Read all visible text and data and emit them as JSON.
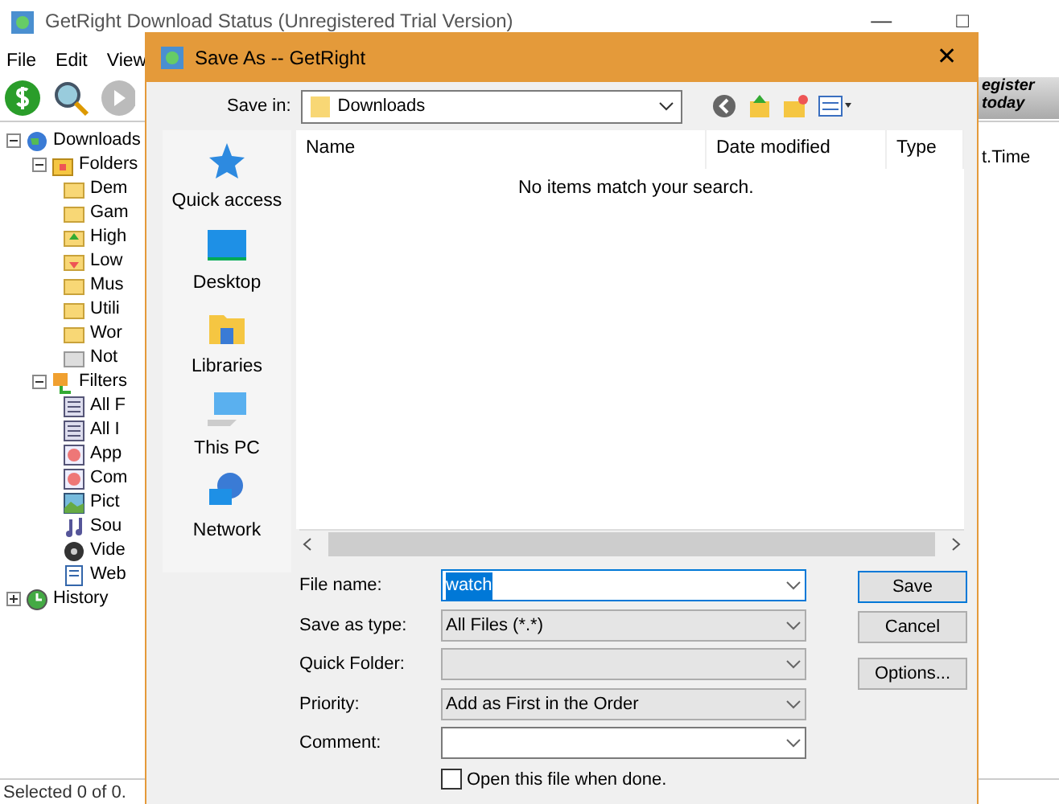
{
  "app": {
    "title": "GetRight Download Status (Unregistered Trial Version)",
    "window_buttons": [
      "—",
      "□"
    ],
    "menu": [
      "File",
      "Edit",
      "View"
    ],
    "tree": [
      {
        "label": "Downloads",
        "kind": "globe",
        "expanded": true,
        "children": [
          {
            "label": "Folders",
            "kind": "folder-special",
            "expanded": true,
            "children": [
              {
                "label": "Dem",
                "kind": "folder"
              },
              {
                "label": "Gam",
                "kind": "folder"
              },
              {
                "label": "High",
                "kind": "folder-up"
              },
              {
                "label": "Low",
                "kind": "folder-down"
              },
              {
                "label": "Mus",
                "kind": "folder"
              },
              {
                "label": "Utili",
                "kind": "folder"
              },
              {
                "label": "Wor",
                "kind": "folder"
              },
              {
                "label": "Not",
                "kind": "folder-gray"
              }
            ]
          },
          {
            "label": "Filters",
            "kind": "filter",
            "expanded": true,
            "children": [
              {
                "label": "All F",
                "kind": "list"
              },
              {
                "label": "All I",
                "kind": "list"
              },
              {
                "label": "App",
                "kind": "app"
              },
              {
                "label": "Com",
                "kind": "app"
              },
              {
                "label": "Pict",
                "kind": "picture-file"
              },
              {
                "label": "Sou",
                "kind": "sound"
              },
              {
                "label": "Vide",
                "kind": "video"
              },
              {
                "label": "Web",
                "kind": "web"
              }
            ]
          }
        ]
      },
      {
        "label": "History",
        "kind": "history",
        "expanded": false
      }
    ],
    "register": [
      "egister",
      "today"
    ],
    "column": "t.Time",
    "status_bar": "Selected 0 of 0."
  },
  "dialog": {
    "title": "Save As -- GetRight",
    "close": "✕",
    "save_in": {
      "label": "Save in:",
      "value": "Downloads"
    },
    "places": [
      "Quick access",
      "Desktop",
      "Libraries",
      "This PC",
      "Network"
    ],
    "columns": [
      "Name",
      "Date modified",
      "Type"
    ],
    "empty_message": "No items match your search.",
    "fields": [
      {
        "label": "File name:",
        "value": "watch",
        "kind": "edit",
        "selected": true
      },
      {
        "label": "Save as type:",
        "value": "All Files (*.*)",
        "kind": "list",
        "selected": false
      },
      {
        "label": "Quick Folder:",
        "kind": "list",
        "selected": false
      },
      {
        "label": "Priority:",
        "value": "Add as First in the Order",
        "kind": "list",
        "selected": false
      },
      {
        "label": "Comment:",
        "kind": "edit",
        "selected": false
      }
    ],
    "checkbox": {
      "label": "Open this file when done.",
      "checked": false
    },
    "buttons": [
      {
        "label": "Save",
        "default": true
      },
      {
        "label": "Cancel",
        "default": false
      },
      {
        "label": "Options...",
        "default": false
      }
    ]
  }
}
